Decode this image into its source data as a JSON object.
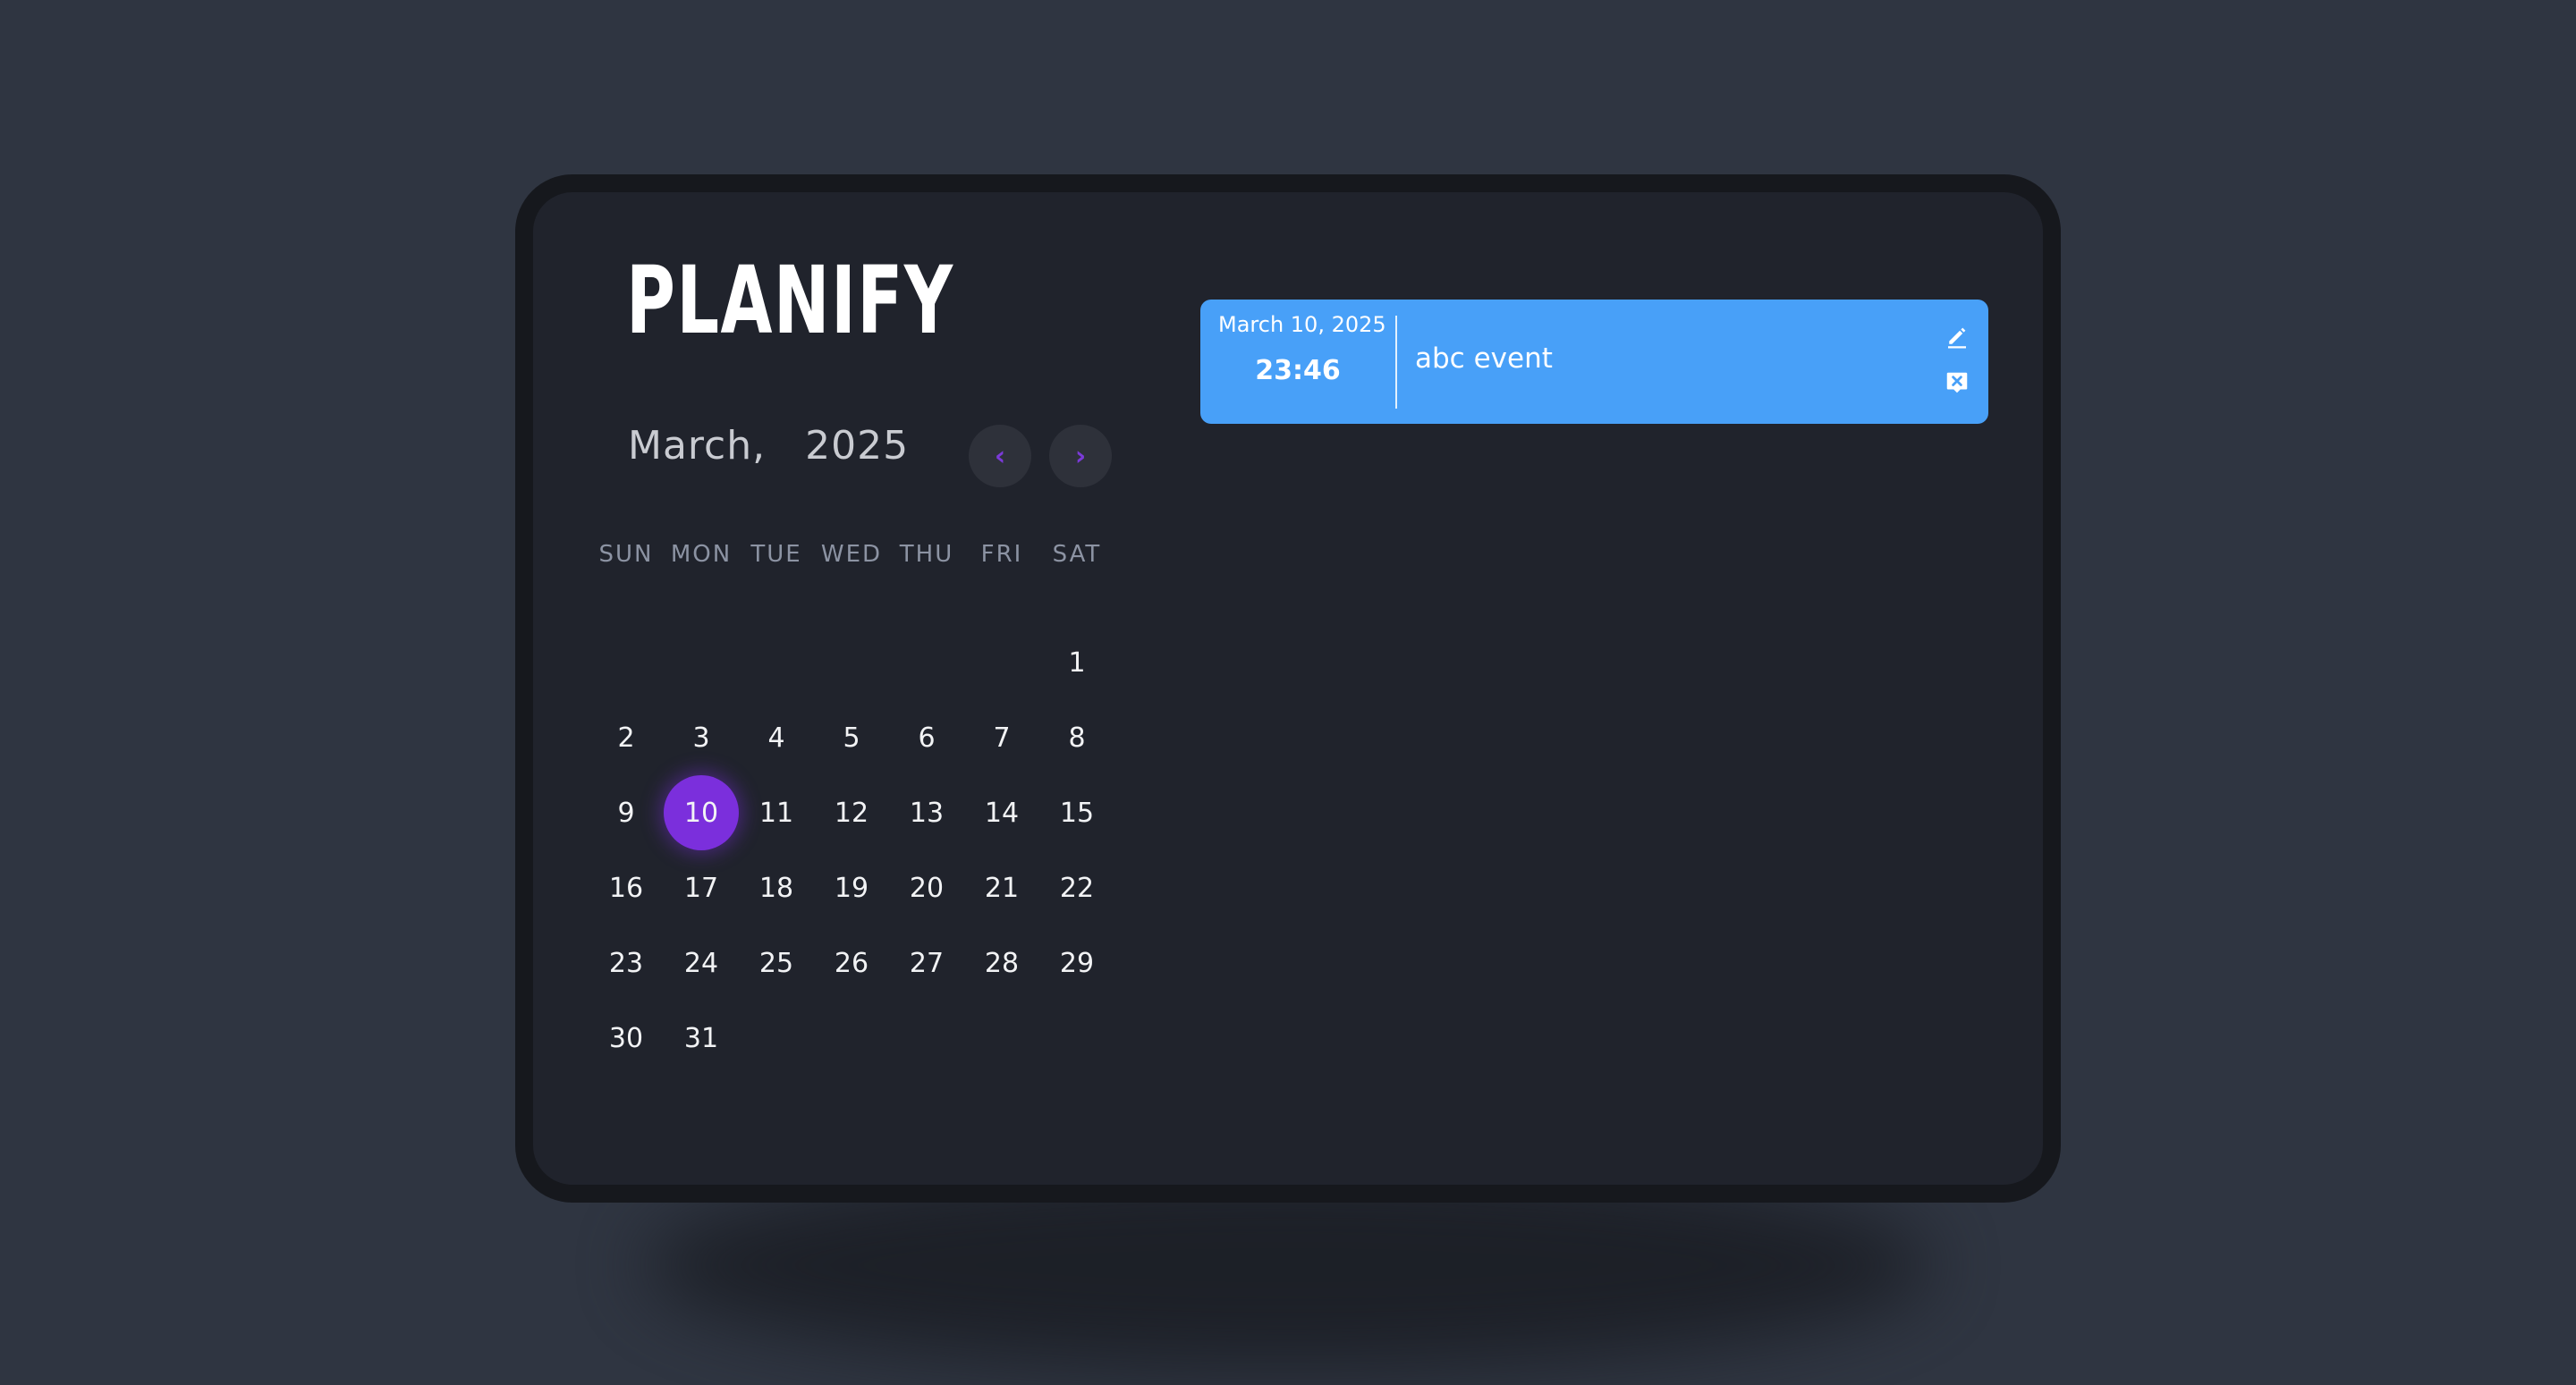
{
  "app": {
    "title": "PLANIFY"
  },
  "calendar": {
    "month": "March,",
    "year": "2025",
    "prev_icon": "chevron-left-icon",
    "next_icon": "chevron-right-icon",
    "prev_label": "‹",
    "next_label": "›",
    "weekdays": [
      "SUN",
      "MON",
      "TUE",
      "WED",
      "THU",
      "FRI",
      "SAT"
    ],
    "leading_blank_days": 6,
    "days": [
      "1",
      "2",
      "3",
      "4",
      "5",
      "6",
      "7",
      "8",
      "9",
      "10",
      "11",
      "12",
      "13",
      "14",
      "15",
      "16",
      "17",
      "18",
      "19",
      "20",
      "21",
      "22",
      "23",
      "24",
      "25",
      "26",
      "27",
      "28",
      "29",
      "30",
      "31"
    ],
    "selected_day": "10",
    "accent_color": "#7b2fdc"
  },
  "events": [
    {
      "date": "March 10, 2025",
      "time": "23:46",
      "title": "abc event",
      "color": "#48a0f8",
      "edit_icon": "pencil-icon",
      "delete_icon": "close-box-icon"
    }
  ]
}
